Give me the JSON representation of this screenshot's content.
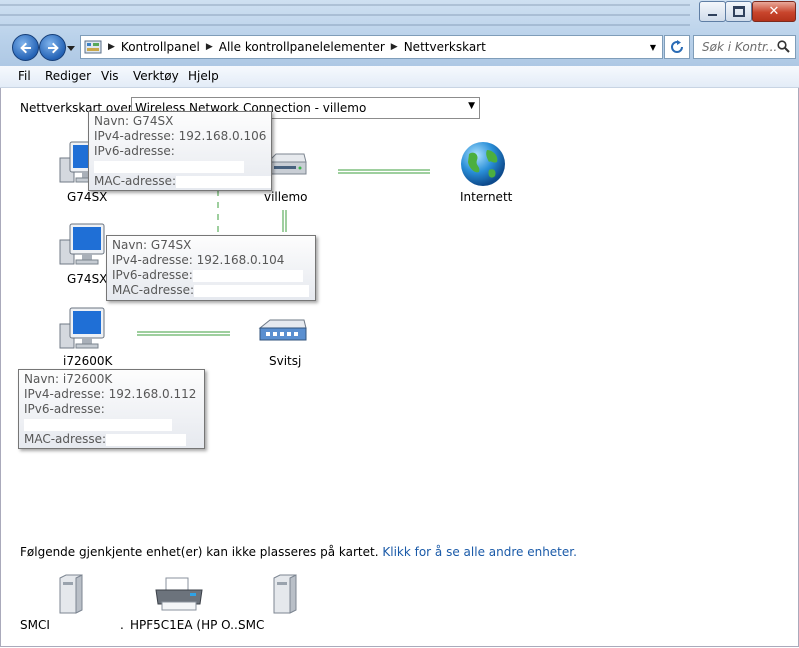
{
  "window": {
    "minimize_glyph": "—",
    "maximize_glyph": "□",
    "close_glyph": "✕"
  },
  "address": {
    "breadcrumbs": [
      "Kontrollpanel",
      "Alle kontrollpanelelementer",
      "Nettverkskart"
    ],
    "search_placeholder": "Søk i Kontr..."
  },
  "menu": [
    "Fil",
    "Rediger",
    "Vis",
    "Verktøy",
    "Hjelp"
  ],
  "map": {
    "label": "Nettverkskart over",
    "selected_network": "Wireless Network Connection - villemo",
    "devices": {
      "g74sx_1": "G74SX",
      "router": "villemo",
      "internet": "Internett",
      "g74sx_2": "G74SX",
      "i72600k": "i72600K",
      "switch": "Svitsj"
    },
    "tooltips": [
      {
        "name": "Navn: G74SX",
        "ipv4": "IPv4-adresse: 192.168.0.106",
        "ipv6": "IPv6-adresse:",
        "mac": "MAC-adresse:"
      },
      {
        "name": "Navn: G74SX",
        "ipv4": "IPv4-adresse: 192.168.0.104",
        "ipv6": "IPv6-adresse:",
        "mac": "MAC-adresse:"
      },
      {
        "name": "Navn: i72600K",
        "ipv4": "IPv4-adresse: 192.168.0.112",
        "ipv6": "IPv6-adresse:",
        "mac": "MAC-adresse:"
      }
    ]
  },
  "unplaced": {
    "message": "Følgende gjenkjente enhet(er) kan ikke plasseres på kartet.",
    "link": "Klikk for å se alle andre enheter.",
    "devices": [
      "SMCI",
      "HPF5C1EA (HP O...",
      "SMC"
    ],
    "ellipsis": "."
  },
  "colors": {
    "link_line": "#7fbf7f",
    "link_blue": "#1a5aa8"
  }
}
